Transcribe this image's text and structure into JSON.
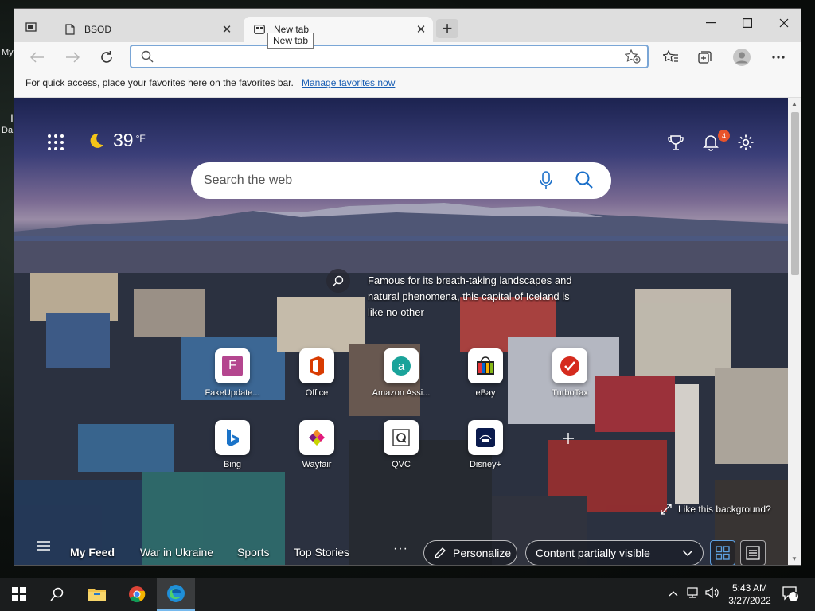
{
  "desktop": {
    "label_top": "My",
    "label_mid": "Da",
    "label_i": "I"
  },
  "browser": {
    "tabs": [
      {
        "label": "BSOD",
        "icon": "document-icon",
        "active": false
      },
      {
        "label": "New tab",
        "icon": "newtab-page-icon",
        "active": true
      }
    ],
    "tooltip": "New tab",
    "close_glyph": "✕",
    "new_tab_glyph": "+",
    "address": {
      "value": "",
      "placeholder": ""
    },
    "favbar": {
      "text": "For quick access, place your favorites here on the favorites bar.",
      "link": "Manage favorites now"
    }
  },
  "newtab": {
    "weather": {
      "temp": "39",
      "unit": "°F",
      "icon": "moon-icon"
    },
    "notifications_count": "4",
    "search": {
      "placeholder": "Search the web"
    },
    "caption": "Famous for its breath-taking landscapes and natural phenomena, this capital of Iceland is like no other",
    "tiles": [
      {
        "name": "FakeUpdate...",
        "icon": "f-icon",
        "color": "#b4468f"
      },
      {
        "name": "Office",
        "icon": "office-icon",
        "color": "#d83b01"
      },
      {
        "name": "Amazon Assi...",
        "icon": "amazon-icon",
        "color": "#1aa39a"
      },
      {
        "name": "eBay",
        "icon": "ebay-icon",
        "color": "#e53238"
      },
      {
        "name": "TurboTax",
        "icon": "turbotax-icon",
        "color": "#d52b1e"
      },
      {
        "name": "Bing",
        "icon": "bing-icon",
        "color": "#1a73c8"
      },
      {
        "name": "Wayfair",
        "icon": "wayfair-icon",
        "color": "#7f187f"
      },
      {
        "name": "QVC",
        "icon": "qvc-icon",
        "color": "#333333"
      },
      {
        "name": "Disney+",
        "icon": "disney-icon",
        "color": "#0b1b4d"
      }
    ],
    "like_background": "Like this background?",
    "feed": {
      "items": [
        "My Feed",
        "War in Ukraine",
        "Sports",
        "Top Stories"
      ],
      "more": "···",
      "personalize": "Personalize",
      "content_visibility": "Content partially visible"
    }
  },
  "taskbar": {
    "time": "5:43 AM",
    "date": "3/27/2022",
    "notification_count": "1"
  }
}
